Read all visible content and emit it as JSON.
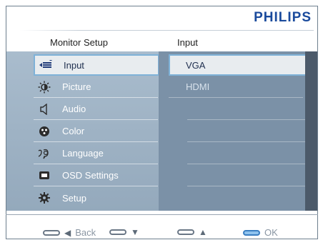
{
  "brand": "PHILIPS",
  "columns": {
    "left_title": "Monitor Setup",
    "right_title": "Input"
  },
  "menu": [
    {
      "label": "Input",
      "icon": "input-icon",
      "selected": true
    },
    {
      "label": "Picture",
      "icon": "picture-icon",
      "selected": false
    },
    {
      "label": "Audio",
      "icon": "audio-icon",
      "selected": false
    },
    {
      "label": "Color",
      "icon": "color-icon",
      "selected": false
    },
    {
      "label": "Language",
      "icon": "language-icon",
      "selected": false
    },
    {
      "label": "OSD Settings",
      "icon": "osd-settings-icon",
      "selected": false
    },
    {
      "label": "Setup",
      "icon": "setup-icon",
      "selected": false
    }
  ],
  "submenu": [
    {
      "label": "VGA",
      "selected": true
    },
    {
      "label": "HDMI",
      "selected": false
    }
  ],
  "nav": {
    "back": {
      "arrow": "◀",
      "label": "Back"
    },
    "down": {
      "arrow": "▼"
    },
    "up": {
      "arrow": "▲"
    },
    "ok": {
      "label": "OK"
    }
  },
  "colors": {
    "brand": "#1a4a9c",
    "selection_border": "#7fb2d8",
    "ok_active": "#8fc3ee"
  }
}
